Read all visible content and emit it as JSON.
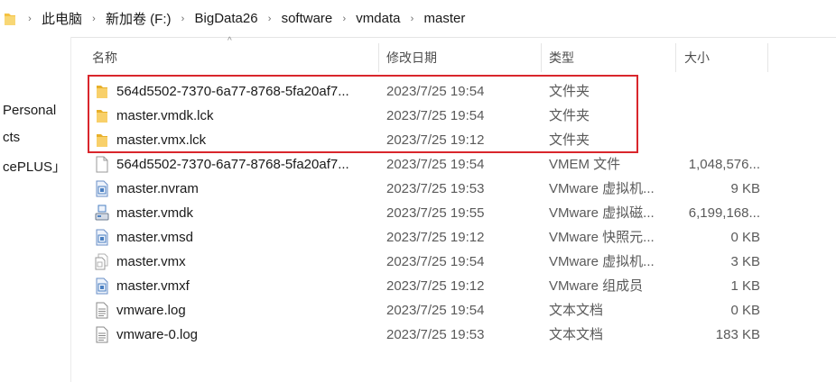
{
  "breadcrumb": {
    "items": [
      "此电脑",
      "新加卷 (F:)",
      "BigData26",
      "software",
      "vmdata",
      "master"
    ]
  },
  "nav": {
    "items": [
      "Personal",
      "cts",
      "cePLUS」"
    ]
  },
  "columns": {
    "name": "名称",
    "date": "修改日期",
    "type": "类型",
    "size": "大小",
    "sort_indicator": "^"
  },
  "files": [
    {
      "name": "564d5502-7370-6a77-8768-5fa20af7...",
      "date": "2023/7/25 19:54",
      "type": "文件夹",
      "size": "",
      "icon": "folder-icon",
      "highlighted": true
    },
    {
      "name": "master.vmdk.lck",
      "date": "2023/7/25 19:54",
      "type": "文件夹",
      "size": "",
      "icon": "folder-icon",
      "highlighted": true
    },
    {
      "name": "master.vmx.lck",
      "date": "2023/7/25 19:12",
      "type": "文件夹",
      "size": "",
      "icon": "folder-icon",
      "highlighted": true
    },
    {
      "name": "564d5502-7370-6a77-8768-5fa20af7...",
      "date": "2023/7/25 19:54",
      "type": "VMEM 文件",
      "size": "1,048,576...",
      "icon": "blank-file-icon"
    },
    {
      "name": "master.nvram",
      "date": "2023/7/25 19:53",
      "type": "VMware 虚拟机...",
      "size": "9 KB",
      "icon": "vmware-file-icon"
    },
    {
      "name": "master.vmdk",
      "date": "2023/7/25 19:55",
      "type": "VMware 虚拟磁...",
      "size": "6,199,168...",
      "icon": "virtual-disk-icon"
    },
    {
      "name": "master.vmsd",
      "date": "2023/7/25 19:12",
      "type": "VMware 快照元...",
      "size": "0 KB",
      "icon": "vmware-file-icon"
    },
    {
      "name": "master.vmx",
      "date": "2023/7/25 19:54",
      "type": "VMware 虚拟机...",
      "size": "3 KB",
      "icon": "vmx-file-icon"
    },
    {
      "name": "master.vmxf",
      "date": "2023/7/25 19:12",
      "type": "VMware 组成员",
      "size": "1 KB",
      "icon": "vmware-file-icon"
    },
    {
      "name": "vmware.log",
      "date": "2023/7/25 19:54",
      "type": "文本文档",
      "size": "0 KB",
      "icon": "text-file-icon"
    },
    {
      "name": "vmware-0.log",
      "date": "2023/7/25 19:53",
      "type": "文本文档",
      "size": "183 KB",
      "icon": "text-file-icon"
    }
  ],
  "colors": {
    "highlight_border": "#d9262c",
    "folder": "#f5c242",
    "vmware_blue": "#4a7fc1"
  }
}
